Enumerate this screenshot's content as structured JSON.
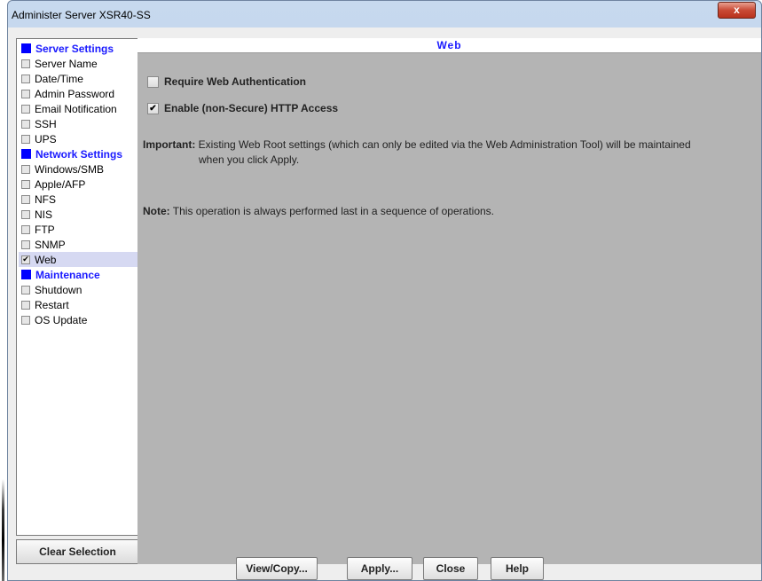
{
  "window": {
    "title": "Administer Server XSR40-SS",
    "close_glyph": "x"
  },
  "sidebar": {
    "items": [
      {
        "label": "Server Settings",
        "type": "header",
        "checked": false
      },
      {
        "label": "Server Name",
        "type": "item",
        "checked": false
      },
      {
        "label": "Date/Time",
        "type": "item",
        "checked": false
      },
      {
        "label": "Admin Password",
        "type": "item",
        "checked": false
      },
      {
        "label": "Email Notification",
        "type": "item",
        "checked": false
      },
      {
        "label": "SSH",
        "type": "item",
        "checked": false
      },
      {
        "label": "UPS",
        "type": "item",
        "checked": false
      },
      {
        "label": "Network Settings",
        "type": "header",
        "checked": false
      },
      {
        "label": "Windows/SMB",
        "type": "item",
        "checked": false
      },
      {
        "label": "Apple/AFP",
        "type": "item",
        "checked": false
      },
      {
        "label": "NFS",
        "type": "item",
        "checked": false
      },
      {
        "label": "NIS",
        "type": "item",
        "checked": false
      },
      {
        "label": "FTP",
        "type": "item",
        "checked": false
      },
      {
        "label": "SNMP",
        "type": "item",
        "checked": false
      },
      {
        "label": "Web",
        "type": "item",
        "checked": true,
        "selected": true
      },
      {
        "label": "Maintenance",
        "type": "header",
        "checked": false
      },
      {
        "label": "Shutdown",
        "type": "item",
        "checked": false
      },
      {
        "label": "Restart",
        "type": "item",
        "checked": false
      },
      {
        "label": "OS Update",
        "type": "item",
        "checked": false
      }
    ],
    "clear_button": "Clear Selection"
  },
  "panel": {
    "title": "Web",
    "options": [
      {
        "label": "Require Web Authentication",
        "checked": false
      },
      {
        "label": "Enable (non-Secure) HTTP Access",
        "checked": true
      }
    ],
    "important_label": "Important:",
    "important_text_line1": "Existing Web Root settings (which can only be edited via the Web Administration Tool) will be maintained",
    "important_text_line2": "when you click Apply.",
    "note_label": "Note:",
    "note_text": "This operation is always performed last in a sequence of operations."
  },
  "buttons": {
    "view_copy": "View/Copy...",
    "apply": "Apply...",
    "close": "Close",
    "help": "Help"
  },
  "check_glyph": "✔",
  "colors": {
    "accent_blue": "#1a1aff",
    "panel_bg": "#b4b4b4",
    "selected_row": "#d6d9f2"
  }
}
